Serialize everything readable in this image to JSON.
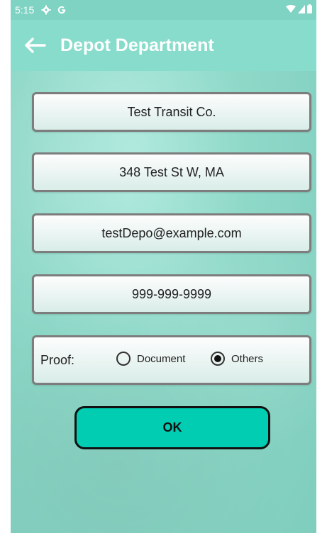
{
  "status_bar": {
    "time": "5:15"
  },
  "app_bar": {
    "title": "Depot Department"
  },
  "form": {
    "company_name": "Test Transit Co.",
    "address": "348 Test St W, MA",
    "email": "testDepo@example.com",
    "phone": "999-999-9999",
    "proof": {
      "label": "Proof:",
      "options": [
        "Document",
        "Others"
      ],
      "selected": "Others"
    },
    "ok_label": "OK"
  },
  "colors": {
    "accent": "#00cdb2",
    "background": "#8ed8c8"
  }
}
